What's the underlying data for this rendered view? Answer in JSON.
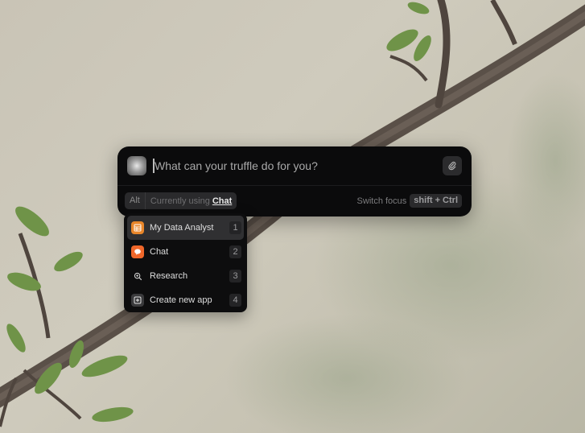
{
  "input": {
    "placeholder": "What can your truffle do for you?"
  },
  "mode": {
    "alt_label": "Alt",
    "using_label": "Currently using",
    "app_name": "Chat"
  },
  "switch_focus": {
    "label": "Switch focus",
    "shortcut": "shift + Ctrl"
  },
  "menu": {
    "items": [
      {
        "label": "My Data Analyst",
        "shortcut": "1",
        "icon": "table-icon",
        "color": "#e8862a"
      },
      {
        "label": "Chat",
        "shortcut": "2",
        "icon": "chat-bubble-icon",
        "color": "#f0672a"
      },
      {
        "label": "Research",
        "shortcut": "3",
        "icon": "magnifier-icon",
        "color": ""
      },
      {
        "label": "Create new app",
        "shortcut": "4",
        "icon": "plus-square-icon",
        "color": "#3a3a3c"
      }
    ]
  }
}
